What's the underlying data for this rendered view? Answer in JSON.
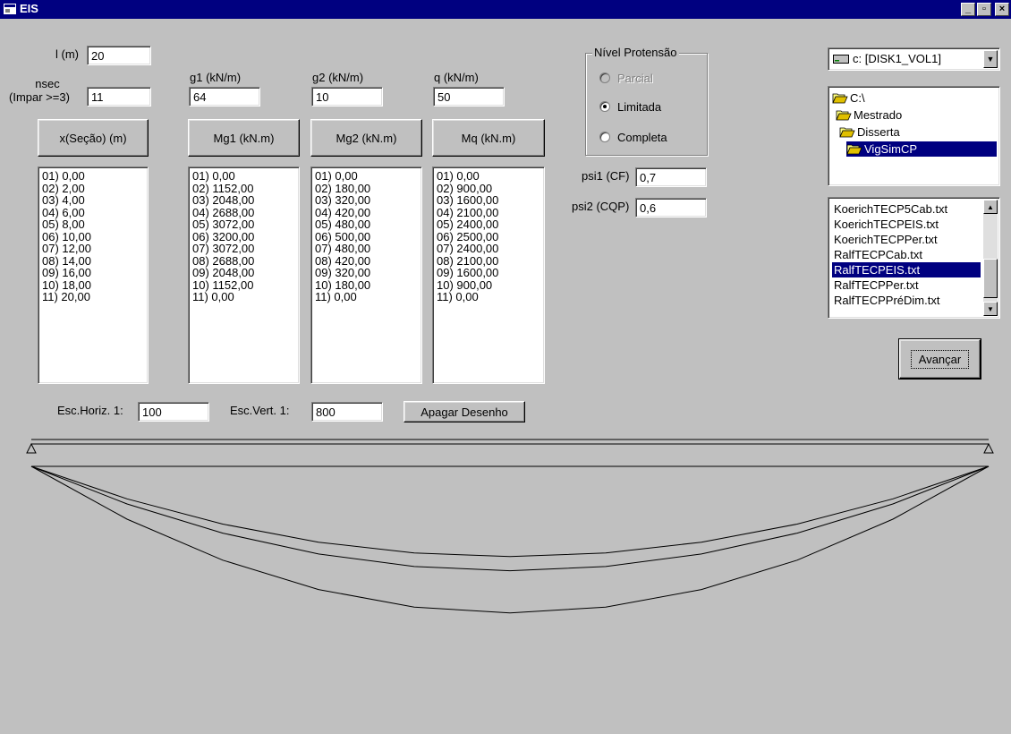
{
  "window": {
    "title": "EIS",
    "minimize_glyph": "_",
    "restore_glyph": "▫",
    "close_glyph": "×"
  },
  "inputs": {
    "l_label": "l (m)",
    "l_value": "20",
    "nsec_label_line1": "nsec",
    "nsec_label_line2": "(Impar >=3)",
    "nsec_value": "11",
    "g1_label": "g1 (kN/m)",
    "g1_value": "64",
    "g2_label": "g2 (kN/m)",
    "g2_value": "10",
    "q_label": "q (kN/m)",
    "q_value": "50",
    "psi1_label": "psi1 (CF)",
    "psi1_value": "0,7",
    "psi2_label": "psi2 (CQP)",
    "psi2_value": "0,6",
    "esc_horiz_label": "Esc.Horiz. 1:",
    "esc_horiz_value": "100",
    "esc_vert_label": "Esc.Vert. 1:",
    "esc_vert_value": "800"
  },
  "buttons": {
    "x_secao": "x(Seção) (m)",
    "mg1": "Mg1 (kN.m)",
    "mg2": "Mg2 (kN.m)",
    "mq": "Mq (kN.m)",
    "apagar": "Apagar Desenho",
    "avancar": "Avançar"
  },
  "lists": {
    "x": [
      "01)  0,00",
      "02)  2,00",
      "03)  4,00",
      "04)  6,00",
      "05)  8,00",
      "06)  10,00",
      "07)  12,00",
      "08)  14,00",
      "09)  16,00",
      "10)  18,00",
      "11)  20,00"
    ],
    "mg1": [
      "01)  0,00",
      "02)  1152,00",
      "03)  2048,00",
      "04)  2688,00",
      "05)  3072,00",
      "06)  3200,00",
      "07)  3072,00",
      "08)  2688,00",
      "09)  2048,00",
      "10)  1152,00",
      "11)  0,00"
    ],
    "mg2": [
      "01)  0,00",
      "02)  180,00",
      "03)  320,00",
      "04)  420,00",
      "05)  480,00",
      "06)  500,00",
      "07)  480,00",
      "08)  420,00",
      "09)  320,00",
      "10)  180,00",
      "11)  0,00"
    ],
    "mq": [
      "01)  0,00",
      "02)  900,00",
      "03)  1600,00",
      "04)  2100,00",
      "05)  2400,00",
      "06)  2500,00",
      "07)  2400,00",
      "08)  2100,00",
      "09)  1600,00",
      "10)  900,00",
      "11)  0,00"
    ]
  },
  "protensao": {
    "title": "Nível Protensão",
    "options": [
      "Parcial",
      "Limitada",
      "Completa"
    ],
    "selected": "Limitada",
    "disabled": [
      "Parcial"
    ]
  },
  "drive": {
    "value": "c: [DISK1_VOL1]"
  },
  "dirs": [
    "C:\\",
    "Mestrado",
    "Disserta",
    "VigSimCP"
  ],
  "dir_selected": "VigSimCP",
  "files": [
    "KoerichTECP5Cab.txt",
    "KoerichTECPEIS.txt",
    "KoerichTECPPer.txt",
    "RalfTECPCab.txt",
    "RalfTECPEIS.txt",
    "RalfTECPPer.txt",
    "RalfTECPPréDim.txt"
  ],
  "file_selected": "RalfTECPEIS.txt",
  "colors": {
    "titlebar": "#000080",
    "face": "#c0c0c0",
    "selection": "#000080"
  },
  "icons": {
    "app": "app-icon",
    "drive": "hard-drive-icon",
    "folder": "folder-icon"
  }
}
